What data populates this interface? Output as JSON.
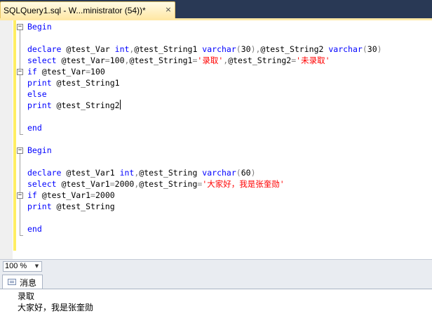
{
  "document_tab": {
    "title": "SQLQuery1.sql - W...ministrator (54))*",
    "close_glyph": "×"
  },
  "editor": {
    "lines": [
      [
        {
          "t": "Begin",
          "c": "kw"
        }
      ],
      [],
      [
        {
          "t": "declare",
          "c": "kw"
        },
        {
          "t": " @test_Var ",
          "c": "fn"
        },
        {
          "t": "int",
          "c": "kw"
        },
        {
          "t": ",",
          "c": "op"
        },
        {
          "t": "@test_String1 ",
          "c": "fn"
        },
        {
          "t": "varchar",
          "c": "kw"
        },
        {
          "t": "(",
          "c": "op"
        },
        {
          "t": "30",
          "c": "fn"
        },
        {
          "t": "),",
          "c": "op"
        },
        {
          "t": "@test_String2 ",
          "c": "fn"
        },
        {
          "t": "varchar",
          "c": "kw"
        },
        {
          "t": "(",
          "c": "op"
        },
        {
          "t": "30",
          "c": "fn"
        },
        {
          "t": ")",
          "c": "op"
        }
      ],
      [
        {
          "t": "select",
          "c": "kw"
        },
        {
          "t": " @test_Var",
          "c": "fn"
        },
        {
          "t": "=",
          "c": "op"
        },
        {
          "t": "100",
          "c": "fn"
        },
        {
          "t": ",",
          "c": "op"
        },
        {
          "t": "@test_String1",
          "c": "fn"
        },
        {
          "t": "=",
          "c": "op"
        },
        {
          "t": "'录取'",
          "c": "str"
        },
        {
          "t": ",",
          "c": "op"
        },
        {
          "t": "@test_String2",
          "c": "fn"
        },
        {
          "t": "=",
          "c": "op"
        },
        {
          "t": "'未录取'",
          "c": "str"
        }
      ],
      [
        {
          "t": "if",
          "c": "kw"
        },
        {
          "t": " @test_Var",
          "c": "fn"
        },
        {
          "t": "=",
          "c": "op"
        },
        {
          "t": "100",
          "c": "fn"
        }
      ],
      [
        {
          "t": "print",
          "c": "kw"
        },
        {
          "t": " @test_String1",
          "c": "fn"
        }
      ],
      [
        {
          "t": "else",
          "c": "kw"
        }
      ],
      [
        {
          "t": "print",
          "c": "kw"
        },
        {
          "t": " @test_String2",
          "c": "fn"
        },
        {
          "t": "|caret|",
          "c": "caret"
        }
      ],
      [],
      [
        {
          "t": "end",
          "c": "kw"
        }
      ],
      [],
      [
        {
          "t": "Begin",
          "c": "kw"
        }
      ],
      [],
      [
        {
          "t": "declare",
          "c": "kw"
        },
        {
          "t": " @test_Var1 ",
          "c": "fn"
        },
        {
          "t": "int",
          "c": "kw"
        },
        {
          "t": ",",
          "c": "op"
        },
        {
          "t": "@test_String ",
          "c": "fn"
        },
        {
          "t": "varchar",
          "c": "kw"
        },
        {
          "t": "(",
          "c": "op"
        },
        {
          "t": "60",
          "c": "fn"
        },
        {
          "t": ")",
          "c": "op"
        }
      ],
      [
        {
          "t": "select",
          "c": "kw"
        },
        {
          "t": " @test_Var1",
          "c": "fn"
        },
        {
          "t": "=",
          "c": "op"
        },
        {
          "t": "2000",
          "c": "fn"
        },
        {
          "t": ",",
          "c": "op"
        },
        {
          "t": "@test_String",
          "c": "fn"
        },
        {
          "t": "=",
          "c": "op"
        },
        {
          "t": "'大家好，我是张奎勋'",
          "c": "str"
        }
      ],
      [
        {
          "t": "if",
          "c": "kw"
        },
        {
          "t": " @test_Var1",
          "c": "fn"
        },
        {
          "t": "=",
          "c": "op"
        },
        {
          "t": "2000",
          "c": "fn"
        }
      ],
      [
        {
          "t": "print",
          "c": "kw"
        },
        {
          "t": " @test_String",
          "c": "fn"
        }
      ],
      [],
      [
        {
          "t": "end",
          "c": "kw"
        }
      ]
    ],
    "colors": {
      "keyword": "#0000ff",
      "string": "#ff0000",
      "operator": "#808080",
      "change_bar": "#ffee62"
    }
  },
  "zoom": {
    "value": "100 %",
    "arrow_icon": "chevron-down-icon"
  },
  "results": {
    "tab_label": "消息",
    "tab_icon": "messages-icon",
    "messages": [
      "录取",
      "大家好，我是张奎勋"
    ]
  }
}
